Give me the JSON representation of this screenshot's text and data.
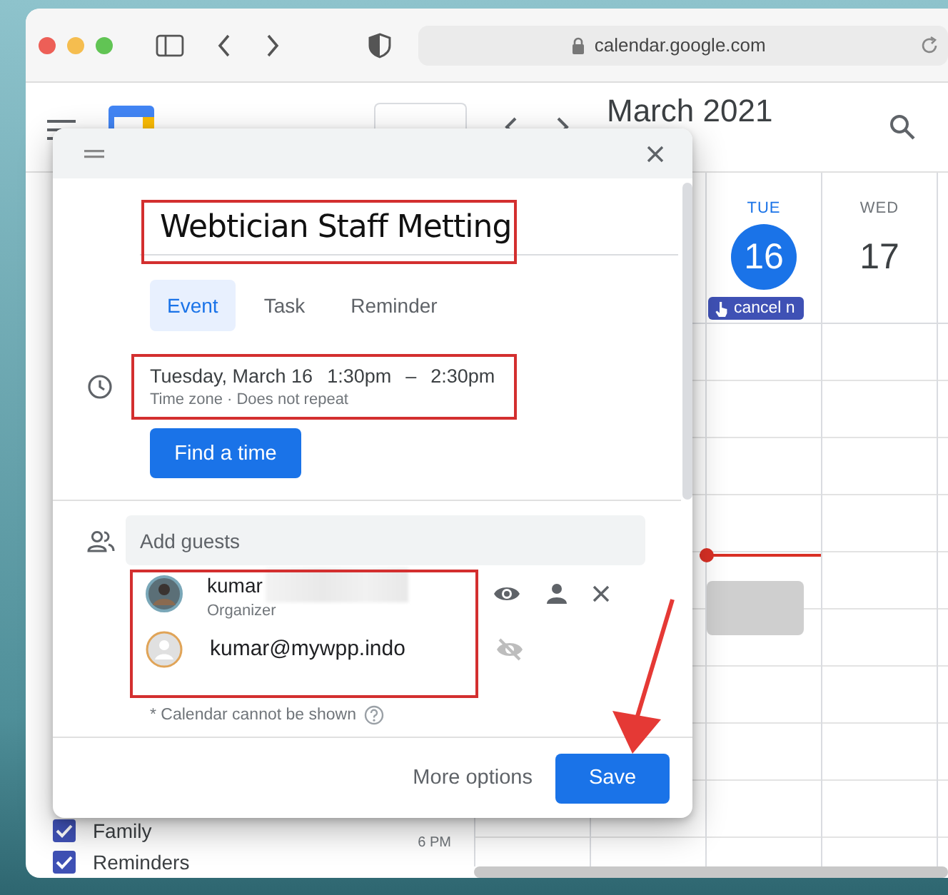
{
  "browser": {
    "url": "calendar.google.com"
  },
  "header": {
    "month": "March 2021"
  },
  "sidebar": {
    "calendars": [
      {
        "label": "Family",
        "checked": true
      },
      {
        "label": "Reminders",
        "checked": true
      }
    ]
  },
  "time_labels": [
    "6 PM"
  ],
  "days": [
    {
      "weekday": "TUE",
      "date": "16",
      "selected": true,
      "events": [
        {
          "label": "cancel n"
        }
      ]
    },
    {
      "weekday": "WED",
      "date": "17",
      "selected": false
    }
  ],
  "dialog": {
    "title": "Webtician Staff Metting",
    "tabs": [
      {
        "label": "Event",
        "selected": true
      },
      {
        "label": "Task",
        "selected": false
      },
      {
        "label": "Reminder",
        "selected": false
      }
    ],
    "date": "Tuesday, March 16",
    "start": "1:30pm",
    "separator": "–",
    "end": "2:30pm",
    "details": "Time zone · Does not repeat",
    "find_time_button": "Find a time",
    "guests": {
      "placeholder": "Add guests",
      "list": [
        {
          "name": "kumar",
          "role": "Organizer",
          "kind": "organizer"
        },
        {
          "name": "kumar@mywpp.indo",
          "kind": "guest"
        }
      ],
      "note": "* Calendar cannot be shown"
    },
    "more_options": "More options",
    "save": "Save"
  }
}
